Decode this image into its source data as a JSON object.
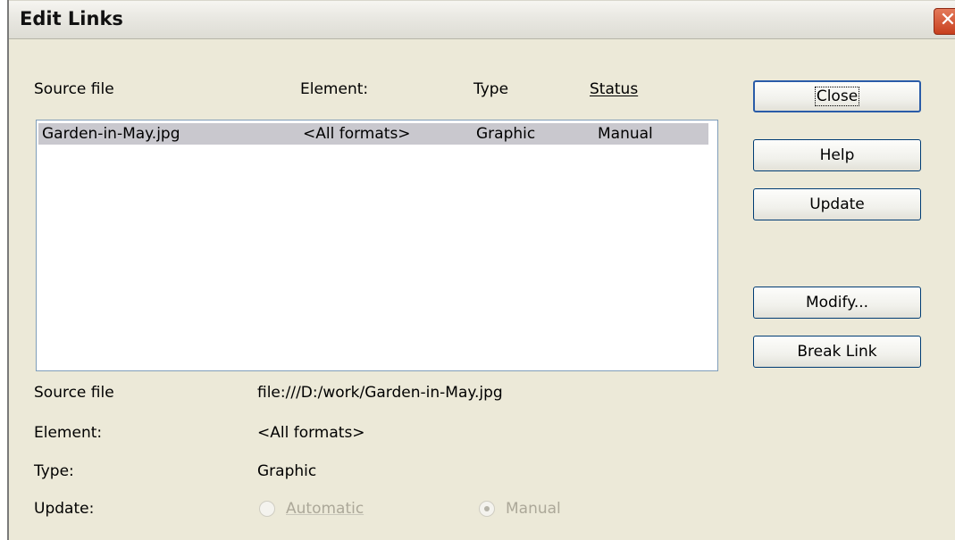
{
  "window": {
    "title": "Edit Links",
    "close_glyph": "✕"
  },
  "list": {
    "headers": {
      "source_file": "Source file",
      "element": "Element:",
      "type": "Type",
      "status": "Status"
    },
    "rows": [
      {
        "source_file": "Garden-in-May.jpg",
        "element": "<All formats>",
        "type": "Graphic",
        "status": "Manual"
      }
    ]
  },
  "buttons": {
    "close": "Close",
    "help": "Help",
    "update": "Update",
    "modify": "Modify...",
    "break_link": "Break Link"
  },
  "details": {
    "source_file_label": "Source file",
    "source_file_value": "file:///D:/work/Garden-in-May.jpg",
    "element_label": "Element:",
    "element_value": "<All formats>",
    "type_label": "Type:",
    "type_value": "Graphic",
    "update_label": "Update:",
    "update_options": {
      "automatic": "Automatic",
      "manual": "Manual"
    },
    "update_selected": "manual"
  }
}
